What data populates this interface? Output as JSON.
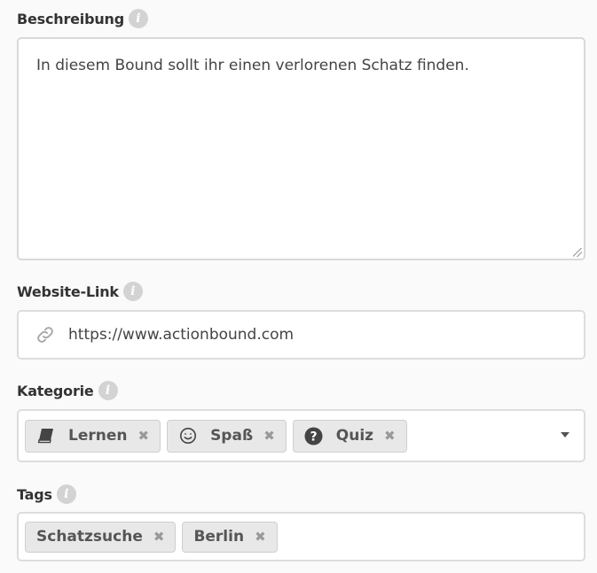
{
  "description": {
    "label": "Beschreibung",
    "value": "In diesem Bound sollt ihr einen verlorenen Schatz finden."
  },
  "website": {
    "label": "Website-Link",
    "value": "https://www.actionbound.com"
  },
  "category": {
    "label": "Kategorie",
    "chips": [
      {
        "label": "Lernen",
        "icon": "book-icon"
      },
      {
        "label": "Spaß",
        "icon": "smiley-icon"
      },
      {
        "label": "Quiz",
        "icon": "question-circle-icon"
      }
    ],
    "remove_glyph": "✖"
  },
  "tags": {
    "label": "Tags",
    "chips": [
      {
        "label": "Schatzsuche"
      },
      {
        "label": "Berlin"
      }
    ],
    "remove_glyph": "✖"
  },
  "info_glyph": "i",
  "colors": {
    "info_icon_bg": "#d3d3d3",
    "chip_bg": "#e8e8e8",
    "border": "#dddddd"
  }
}
